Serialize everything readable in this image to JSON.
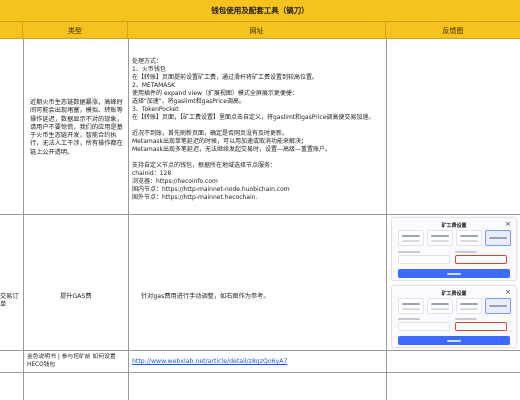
{
  "title": "钱包使用及配套工具（镐刀）",
  "headers": {
    "type": "类型",
    "url": "网址",
    "feedback": "反馈图"
  },
  "row1": {
    "type_text": "近期火币生态链数据暴涨，高峰时间可能会出现堵塞，模拟、转账等操作延迟，数据显示不对的现象，请用户不要惊慌，我们的应用是基于火币生态链开发，智能合约执行，无法人工干涉，所有操作都在链上公开透明。",
    "desc_lines": [
      "处理方式：",
      "1、火币钱包",
      "在【转账】页面提前设置矿工费，通过滑杆将矿工费设置到较高位置。",
      "2、METAMASK",
      "使用插件的 expand view（扩展视图）模式全屏展示更便捷：",
      "选择\"加速\"，将gaslimt和gasPrice调高。",
      "3、TokenPocket",
      "在【转账】页面，【矿工费设置】里面点击自定义，将gaslimt和gasPrice调高便交易加速。",
      "",
      "近况不到账，首先刷新页面，确定是否网页没有及时更新。",
      "Metamask出现单笔延迟的时候，可以用加速或取消功能来解决；",
      "Metamask出现多笔延迟，无法继续发起交易时，设置—高级—重置账户。",
      "",
      "支持自定义节点的钱包，根据所在地域选择节点服务：",
      "chainid：128",
      "浏览器：https://hecoinfo.com",
      "国内节点：https://http-mainnet-node.huobichain.com",
      "国外节点：https://http-mainnet.hecochain."
    ]
  },
  "row2": {
    "left_text": "交易订单",
    "type_text": "提升GAS费",
    "desc_text": "针对gas费用进行手动调整，如右图作为参考。",
    "thumb_title_1": "矿工费设置",
    "thumb_title_2": "矿工费设置"
  },
  "row3": {
    "type_text": "金色说明书 | 参与挖矿前 如何设置HECO钱包",
    "link_text": "http://www.webxlab.net/article/detail/z8gzQo6yA7"
  },
  "colors": {
    "header_bg": "#f6c21d",
    "grid": "#9a9a9a",
    "link": "#1a56d6",
    "highlight": "#e0452b",
    "button": "#3d6bff"
  }
}
